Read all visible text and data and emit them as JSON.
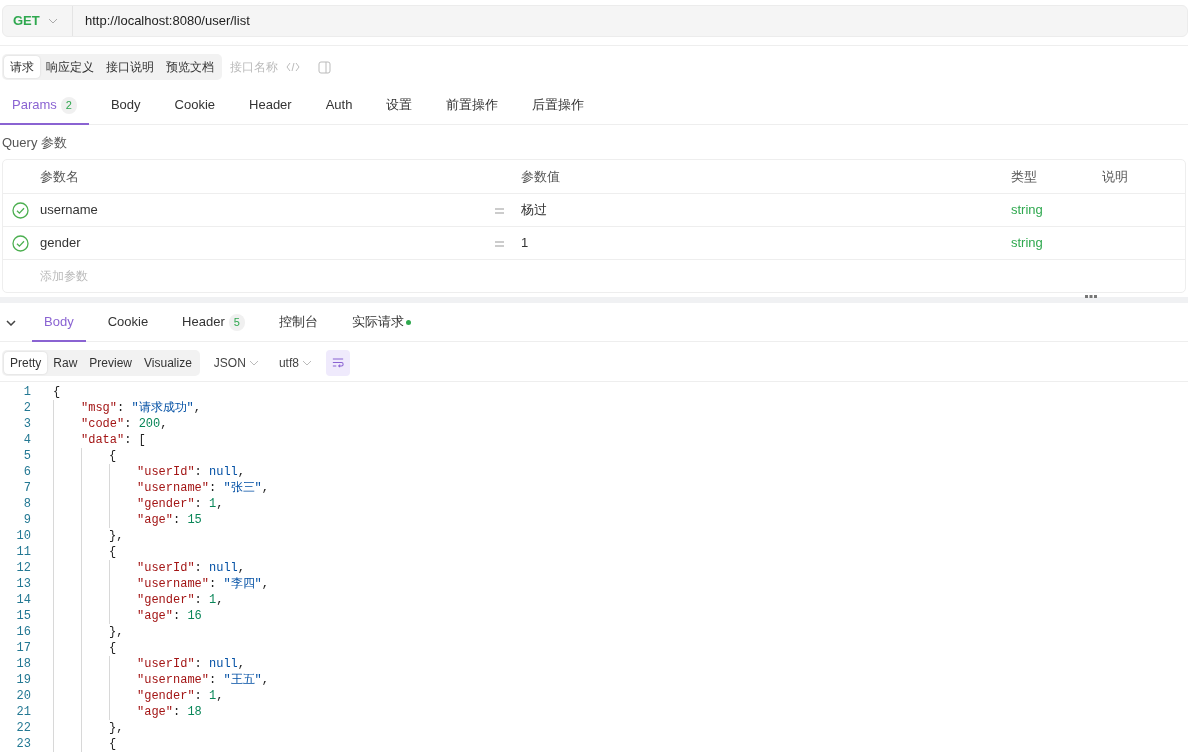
{
  "request": {
    "method": "GET",
    "url": "http://localhost:8080/user/list"
  },
  "doc_tabs": [
    {
      "label": "请求",
      "selected": true
    },
    {
      "label": "响应定义",
      "selected": false
    },
    {
      "label": "接口说明",
      "selected": false
    },
    {
      "label": "预览文档",
      "selected": false
    }
  ],
  "name_placeholder": "接口名称",
  "request_tabs": [
    {
      "label": "Params",
      "badge": "2",
      "selected": true
    },
    {
      "label": "Body",
      "selected": false
    },
    {
      "label": "Cookie",
      "selected": false
    },
    {
      "label": "Header",
      "selected": false
    },
    {
      "label": "Auth",
      "selected": false
    },
    {
      "label": "设置",
      "selected": false
    },
    {
      "label": "前置操作",
      "selected": false
    },
    {
      "label": "后置操作",
      "selected": false
    }
  ],
  "query_label": "Query 参数",
  "params": {
    "columns": [
      "参数名",
      "参数值",
      "类型",
      "说明"
    ],
    "rows": [
      {
        "enabled": true,
        "name": "username",
        "value": "杨过",
        "type": "string"
      },
      {
        "enabled": true,
        "name": "gender",
        "value": "1",
        "type": "string"
      }
    ],
    "add_placeholder": "添加参数"
  },
  "response_tabs": [
    {
      "label": "Body",
      "selected": true,
      "dot": false
    },
    {
      "label": "Cookie",
      "selected": false,
      "dot": false
    },
    {
      "label": "Header",
      "badge": "5",
      "selected": false,
      "dot": false
    },
    {
      "label": "控制台",
      "selected": false,
      "dot": false
    },
    {
      "label": "实际请求",
      "selected": false,
      "dot": true
    }
  ],
  "view_modes": [
    {
      "label": "Pretty",
      "selected": true
    },
    {
      "label": "Raw",
      "selected": false
    },
    {
      "label": "Preview",
      "selected": false
    },
    {
      "label": "Visualize",
      "selected": false
    }
  ],
  "format": "JSON",
  "encoding": "utf8",
  "wrap": true,
  "code": [
    {
      "number": "1",
      "tokens": [
        {
          "kind": "punct",
          "text": "{"
        }
      ],
      "children": [
        {
          "number": "2",
          "tokens": [
            {
              "kind": "key",
              "text": "\"msg\""
            },
            {
              "kind": "punct",
              "text": ": "
            },
            {
              "kind": "string",
              "text": "\"请求成功\""
            },
            {
              "kind": "punct",
              "text": ","
            }
          ]
        },
        {
          "number": "3",
          "tokens": [
            {
              "kind": "key",
              "text": "\"code\""
            },
            {
              "kind": "punct",
              "text": ": "
            },
            {
              "kind": "number",
              "text": "200"
            },
            {
              "kind": "punct",
              "text": ","
            }
          ]
        },
        {
          "number": "4",
          "tokens": [
            {
              "kind": "key",
              "text": "\"data\""
            },
            {
              "kind": "punct",
              "text": ": ["
            }
          ],
          "children": [
            {
              "number": "5",
              "tokens": [
                {
                  "kind": "punct",
                  "text": "{"
                }
              ],
              "children": [
                {
                  "number": "6",
                  "tokens": [
                    {
                      "kind": "key",
                      "text": "\"userId\""
                    },
                    {
                      "kind": "punct",
                      "text": ": "
                    },
                    {
                      "kind": "null",
                      "text": "null"
                    },
                    {
                      "kind": "punct",
                      "text": ","
                    }
                  ]
                },
                {
                  "number": "7",
                  "tokens": [
                    {
                      "kind": "key",
                      "text": "\"username\""
                    },
                    {
                      "kind": "punct",
                      "text": ": "
                    },
                    {
                      "kind": "string",
                      "text": "\"张三\""
                    },
                    {
                      "kind": "punct",
                      "text": ","
                    }
                  ]
                },
                {
                  "number": "8",
                  "tokens": [
                    {
                      "kind": "key",
                      "text": "\"gender\""
                    },
                    {
                      "kind": "punct",
                      "text": ": "
                    },
                    {
                      "kind": "number",
                      "text": "1"
                    },
                    {
                      "kind": "punct",
                      "text": ","
                    }
                  ]
                },
                {
                  "number": "9",
                  "tokens": [
                    {
                      "kind": "key",
                      "text": "\"age\""
                    },
                    {
                      "kind": "punct",
                      "text": ": "
                    },
                    {
                      "kind": "number",
                      "text": "15"
                    }
                  ]
                }
              ]
            },
            {
              "number": "10",
              "tokens": [
                {
                  "kind": "punct",
                  "text": "},"
                }
              ]
            },
            {
              "number": "11",
              "tokens": [
                {
                  "kind": "punct",
                  "text": "{"
                }
              ],
              "children": [
                {
                  "number": "12",
                  "tokens": [
                    {
                      "kind": "key",
                      "text": "\"userId\""
                    },
                    {
                      "kind": "punct",
                      "text": ": "
                    },
                    {
                      "kind": "null",
                      "text": "null"
                    },
                    {
                      "kind": "punct",
                      "text": ","
                    }
                  ]
                },
                {
                  "number": "13",
                  "tokens": [
                    {
                      "kind": "key",
                      "text": "\"username\""
                    },
                    {
                      "kind": "punct",
                      "text": ": "
                    },
                    {
                      "kind": "string",
                      "text": "\"李四\""
                    },
                    {
                      "kind": "punct",
                      "text": ","
                    }
                  ]
                },
                {
                  "number": "14",
                  "tokens": [
                    {
                      "kind": "key",
                      "text": "\"gender\""
                    },
                    {
                      "kind": "punct",
                      "text": ": "
                    },
                    {
                      "kind": "number",
                      "text": "1"
                    },
                    {
                      "kind": "punct",
                      "text": ","
                    }
                  ]
                },
                {
                  "number": "15",
                  "tokens": [
                    {
                      "kind": "key",
                      "text": "\"age\""
                    },
                    {
                      "kind": "punct",
                      "text": ": "
                    },
                    {
                      "kind": "number",
                      "text": "16"
                    }
                  ]
                }
              ]
            },
            {
              "number": "16",
              "tokens": [
                {
                  "kind": "punct",
                  "text": "},"
                }
              ]
            },
            {
              "number": "17",
              "tokens": [
                {
                  "kind": "punct",
                  "text": "{"
                }
              ],
              "children": [
                {
                  "number": "18",
                  "tokens": [
                    {
                      "kind": "key",
                      "text": "\"userId\""
                    },
                    {
                      "kind": "punct",
                      "text": ": "
                    },
                    {
                      "kind": "null",
                      "text": "null"
                    },
                    {
                      "kind": "punct",
                      "text": ","
                    }
                  ]
                },
                {
                  "number": "19",
                  "tokens": [
                    {
                      "kind": "key",
                      "text": "\"username\""
                    },
                    {
                      "kind": "punct",
                      "text": ": "
                    },
                    {
                      "kind": "string",
                      "text": "\"王五\""
                    },
                    {
                      "kind": "punct",
                      "text": ","
                    }
                  ]
                },
                {
                  "number": "20",
                  "tokens": [
                    {
                      "kind": "key",
                      "text": "\"gender\""
                    },
                    {
                      "kind": "punct",
                      "text": ": "
                    },
                    {
                      "kind": "number",
                      "text": "1"
                    },
                    {
                      "kind": "punct",
                      "text": ","
                    }
                  ]
                },
                {
                  "number": "21",
                  "tokens": [
                    {
                      "kind": "key",
                      "text": "\"age\""
                    },
                    {
                      "kind": "punct",
                      "text": ": "
                    },
                    {
                      "kind": "number",
                      "text": "18"
                    }
                  ]
                }
              ]
            },
            {
              "number": "22",
              "tokens": [
                {
                  "kind": "punct",
                  "text": "},"
                }
              ]
            },
            {
              "number": "23",
              "tokens": [
                {
                  "kind": "punct",
                  "text": "{"
                }
              ]
            }
          ]
        }
      ]
    }
  ]
}
